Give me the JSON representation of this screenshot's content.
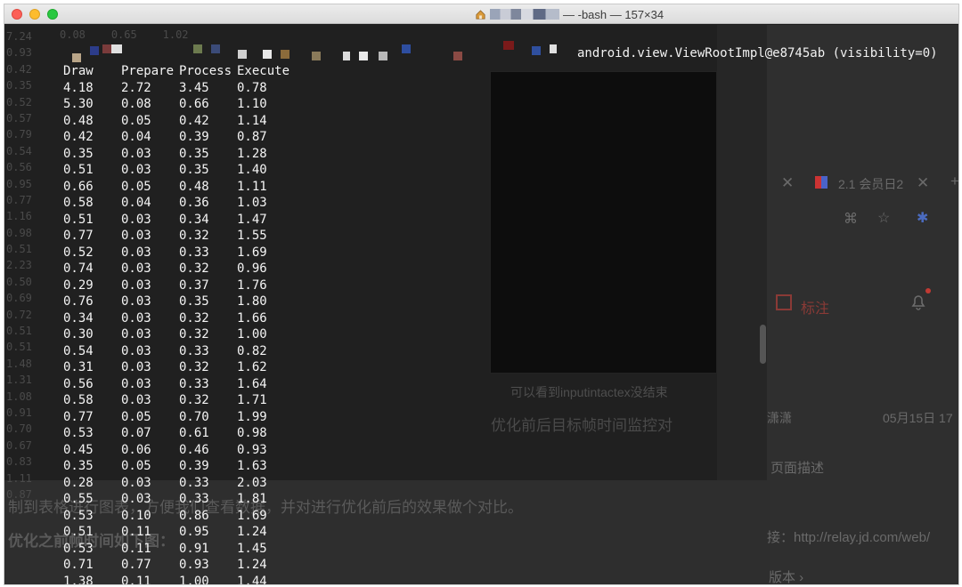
{
  "window": {
    "title": "— -bash — 157×34"
  },
  "terminal": {
    "log_line": "android.view.ViewRootImpl@e8745ab (visibility=0)",
    "headers": [
      "Draw",
      "Prepare",
      "Process",
      "Execute"
    ],
    "rows": [
      [
        "4.18",
        "2.72",
        "3.45",
        "0.78"
      ],
      [
        "5.30",
        "0.08",
        "0.66",
        "1.10"
      ],
      [
        "0.48",
        "0.05",
        "0.42",
        "1.14"
      ],
      [
        "0.42",
        "0.04",
        "0.39",
        "0.87"
      ],
      [
        "0.35",
        "0.03",
        "0.35",
        "1.28"
      ],
      [
        "0.51",
        "0.03",
        "0.35",
        "1.40"
      ],
      [
        "0.66",
        "0.05",
        "0.48",
        "1.11"
      ],
      [
        "0.58",
        "0.04",
        "0.36",
        "1.03"
      ],
      [
        "0.51",
        "0.03",
        "0.34",
        "1.47"
      ],
      [
        "0.77",
        "0.03",
        "0.32",
        "1.55"
      ],
      [
        "0.52",
        "0.03",
        "0.33",
        "1.69"
      ],
      [
        "0.74",
        "0.03",
        "0.32",
        "0.96"
      ],
      [
        "0.29",
        "0.03",
        "0.37",
        "1.76"
      ],
      [
        "0.76",
        "0.03",
        "0.35",
        "1.80"
      ],
      [
        "0.34",
        "0.03",
        "0.32",
        "1.66"
      ],
      [
        "0.30",
        "0.03",
        "0.32",
        "1.00"
      ],
      [
        "0.54",
        "0.03",
        "0.33",
        "0.82"
      ],
      [
        "0.31",
        "0.03",
        "0.32",
        "1.62"
      ],
      [
        "0.56",
        "0.03",
        "0.33",
        "1.64"
      ],
      [
        "0.58",
        "0.03",
        "0.32",
        "1.71"
      ],
      [
        "0.77",
        "0.05",
        "0.70",
        "1.99"
      ],
      [
        "0.53",
        "0.07",
        "0.61",
        "0.98"
      ],
      [
        "0.45",
        "0.06",
        "0.46",
        "0.93"
      ],
      [
        "0.35",
        "0.05",
        "0.39",
        "1.63"
      ],
      [
        "0.28",
        "0.03",
        "0.33",
        "2.03"
      ],
      [
        "0.55",
        "0.03",
        "0.33",
        "1.81"
      ],
      [
        "0.53",
        "0.10",
        "0.86",
        "1.69"
      ],
      [
        "0.51",
        "0.11",
        "0.95",
        "1.24"
      ],
      [
        "0.53",
        "0.11",
        "0.91",
        "1.45"
      ],
      [
        "0.71",
        "0.77",
        "0.93",
        "1.24"
      ],
      [
        "1.38",
        "0.11",
        "1.00",
        "1.44"
      ]
    ],
    "left_column": [
      "7.24",
      "0.93",
      "0.42",
      "0.35",
      "0.52",
      "0.57",
      "0.79",
      "0.54",
      "0.56",
      "0.95",
      "0.77",
      "1.16",
      "0.98",
      "0.51",
      "2.23",
      "0.50",
      "0.69",
      "0.72",
      "0.51",
      "0.51",
      "1.48",
      "1.31",
      "1.08",
      "0.91",
      "0.70",
      "0.67",
      "0.83",
      "1.11",
      "0.87"
    ],
    "top_partial": [
      "0.08",
      "0.65",
      "1.02"
    ]
  },
  "background": {
    "tab_label": "2.1 会员日2",
    "mark_label": "标注",
    "section_heading": "优化前后目标帧时间监控对",
    "section_hint": "可以看到inputintactex没结束",
    "doc_line_1": "制到表格进行图表，方便我们查看数据，并对进行优化前后的效果做个对比。",
    "doc_line_2": "优化之前帧时间如下图：",
    "right_author": "潇潇",
    "right_date": "05月15日 17",
    "right_desc": "页面描述",
    "right_url": "接：http://relay.jd.com/web/",
    "right_version": "版本 ›"
  }
}
